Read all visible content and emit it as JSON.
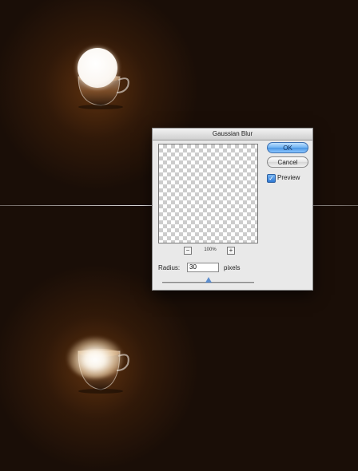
{
  "dialog": {
    "title": "Gaussian Blur",
    "ok_label": "OK",
    "cancel_label": "Cancel",
    "preview_label": "Preview",
    "preview_checked": true,
    "zoom_level": "100%",
    "zoom_minus_label": "−",
    "zoom_plus_label": "+",
    "radius_label": "Radius:",
    "radius_value": "30",
    "radius_units": "pixels",
    "radius_slider_fraction": 0.5
  },
  "icons": {
    "checkmark": "✓"
  },
  "colors": {
    "background": "#1a0e07",
    "glow": "#964e14",
    "ok_button": "#6fb2f1"
  }
}
